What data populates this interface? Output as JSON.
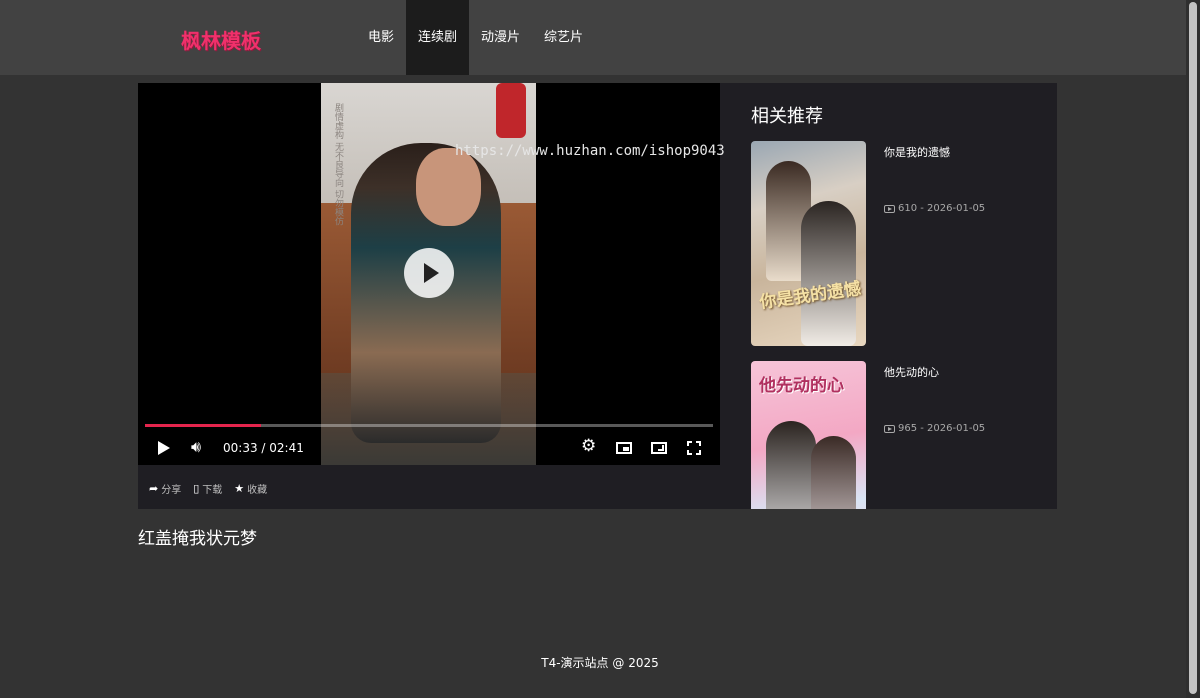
{
  "header": {
    "logo": "枫林模板",
    "nav": [
      {
        "label": "电影",
        "active": false
      },
      {
        "label": "连续剧",
        "active": true
      },
      {
        "label": "动漫片",
        "active": false
      },
      {
        "label": "综艺片",
        "active": false
      }
    ]
  },
  "player": {
    "watermark": "https://www.huzhan.com/ishop9043",
    "frame_caption": "剧情虚构 无不良导向 切勿模仿",
    "current_time": "00:33",
    "duration": "02:41",
    "time_text": "00:33 / 02:41",
    "progress_fraction": 0.205,
    "accent_color": "#e4254d"
  },
  "actions": [
    {
      "label": "分享",
      "icon": "share-icon"
    },
    {
      "label": "下载",
      "icon": "phone-icon"
    },
    {
      "label": "收藏",
      "icon": "star-icon"
    }
  ],
  "related": {
    "title": "相关推荐",
    "items": [
      {
        "name": "你是我的遗憾",
        "poster_text": "你是我的遗憾",
        "views": "610",
        "date": "2026-01-05",
        "meta": "610 - 2026-01-05"
      },
      {
        "name": "他先动的心",
        "poster_text": "他先动的心",
        "views": "965",
        "date": "2026-01-05",
        "meta": "965 - 2026-01-05"
      }
    ]
  },
  "page_title": "红盖掩我状元梦",
  "footer": "T4-演示站点 @ 2025",
  "colors": {
    "logo": "#f0306b",
    "header_bg": "#424242",
    "page_bg": "#333333",
    "panel_bg": "#1f1e23"
  }
}
